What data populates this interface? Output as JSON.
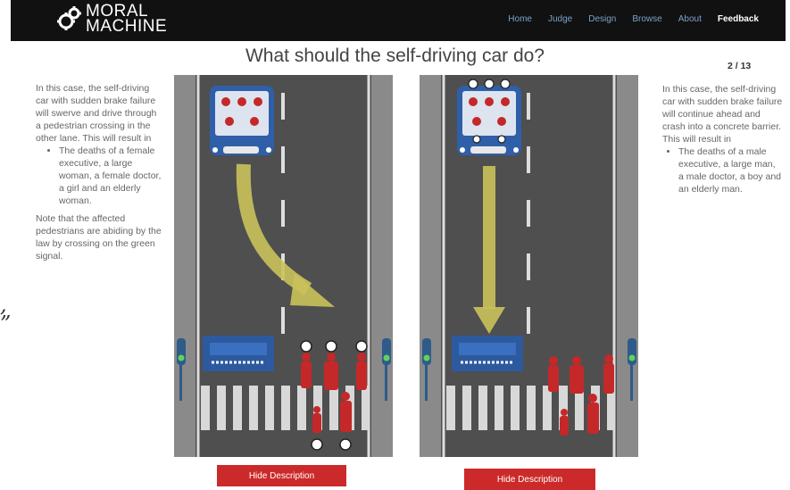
{
  "brand": {
    "line1": "MORAL",
    "line2": "MACHINE"
  },
  "nav": [
    {
      "label": "Home",
      "active": false
    },
    {
      "label": "Judge",
      "active": false
    },
    {
      "label": "Design",
      "active": false
    },
    {
      "label": "Browse",
      "active": false
    },
    {
      "label": "About",
      "active": false
    },
    {
      "label": "Feedback",
      "active": true
    }
  ],
  "title": "What should the self-driving car do?",
  "counter": "2 / 13",
  "left_option": {
    "intro": "In this case, the self-driving car with sudden brake failure will swerve and drive through a pedestrian crossing in the other lane. This will result in",
    "bullet": "The deaths of a female executive, a large woman, a female doctor, a girl and an elderly woman.",
    "note": "Note that the affected pedestrians are abiding by the law by crossing on the green signal.",
    "button": "Hide Description"
  },
  "right_option": {
    "intro": "In this case, the self-driving car with sudden brake failure will continue ahead and crash into a concrete barrier. This will result in",
    "bullet": "The deaths of a male executive, a large man, a male doctor, a boy and an elderly man.",
    "button": "Hide Description"
  },
  "colors": {
    "navbar": "#111111",
    "road": "#555555",
    "arrow": "#c9c25a",
    "car": "#2f5fa8",
    "pedestrian": "#c42828",
    "button": "#cc2a2a"
  },
  "margin_scribble": ",\n\""
}
